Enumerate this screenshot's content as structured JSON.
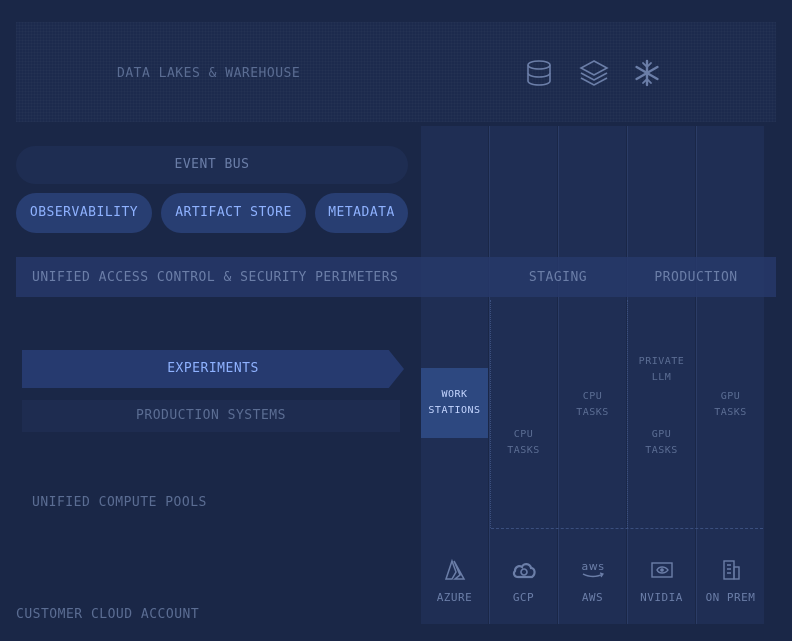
{
  "data_lakes": {
    "label": "DATA LAKES & WAREHOUSE",
    "icons": [
      "database-icon",
      "layers-icon",
      "snowflake-icon"
    ]
  },
  "event_bus": {
    "label": "EVENT BUS"
  },
  "services": [
    "OBSERVABILITY",
    "ARTIFACT STORE",
    "METADATA"
  ],
  "access_control": {
    "label": "UNIFIED ACCESS CONTROL & SECURITY PERIMETERS"
  },
  "stages": {
    "staging": "STAGING",
    "production": "PRODUCTION"
  },
  "workloads": {
    "experiments": "EXPERIMENTS",
    "production_systems": "PRODUCTION SYSTEMS"
  },
  "work_stations": {
    "line1": "WORK",
    "line2": "STATIONS"
  },
  "tasks": {
    "gcp_cpu": [
      "CPU",
      "TASKS"
    ],
    "aws_cpu": [
      "CPU",
      "TASKS"
    ],
    "private_llm": [
      "PRIVATE",
      "LLM"
    ],
    "nvidia_gpu": [
      "GPU",
      "TASKS"
    ],
    "onprem_gpu": [
      "GPU",
      "TASKS"
    ]
  },
  "compute_pools": {
    "label": "UNIFIED COMPUTE POOLS"
  },
  "vendors": [
    {
      "label": "AZURE",
      "icon": "azure-icon"
    },
    {
      "label": "GCP",
      "icon": "gcp-cloud-icon"
    },
    {
      "label": "AWS",
      "icon": "aws-icon"
    },
    {
      "label": "NVIDIA",
      "icon": "nvidia-icon"
    },
    {
      "label": "ON PREM",
      "icon": "building-icon"
    }
  ],
  "customer_account": {
    "label": "CUSTOMER CLOUD ACCOUNT"
  },
  "colors": {
    "background": "#1a2747",
    "accent": "#8fb2ff",
    "muted": "#5b6d93"
  }
}
